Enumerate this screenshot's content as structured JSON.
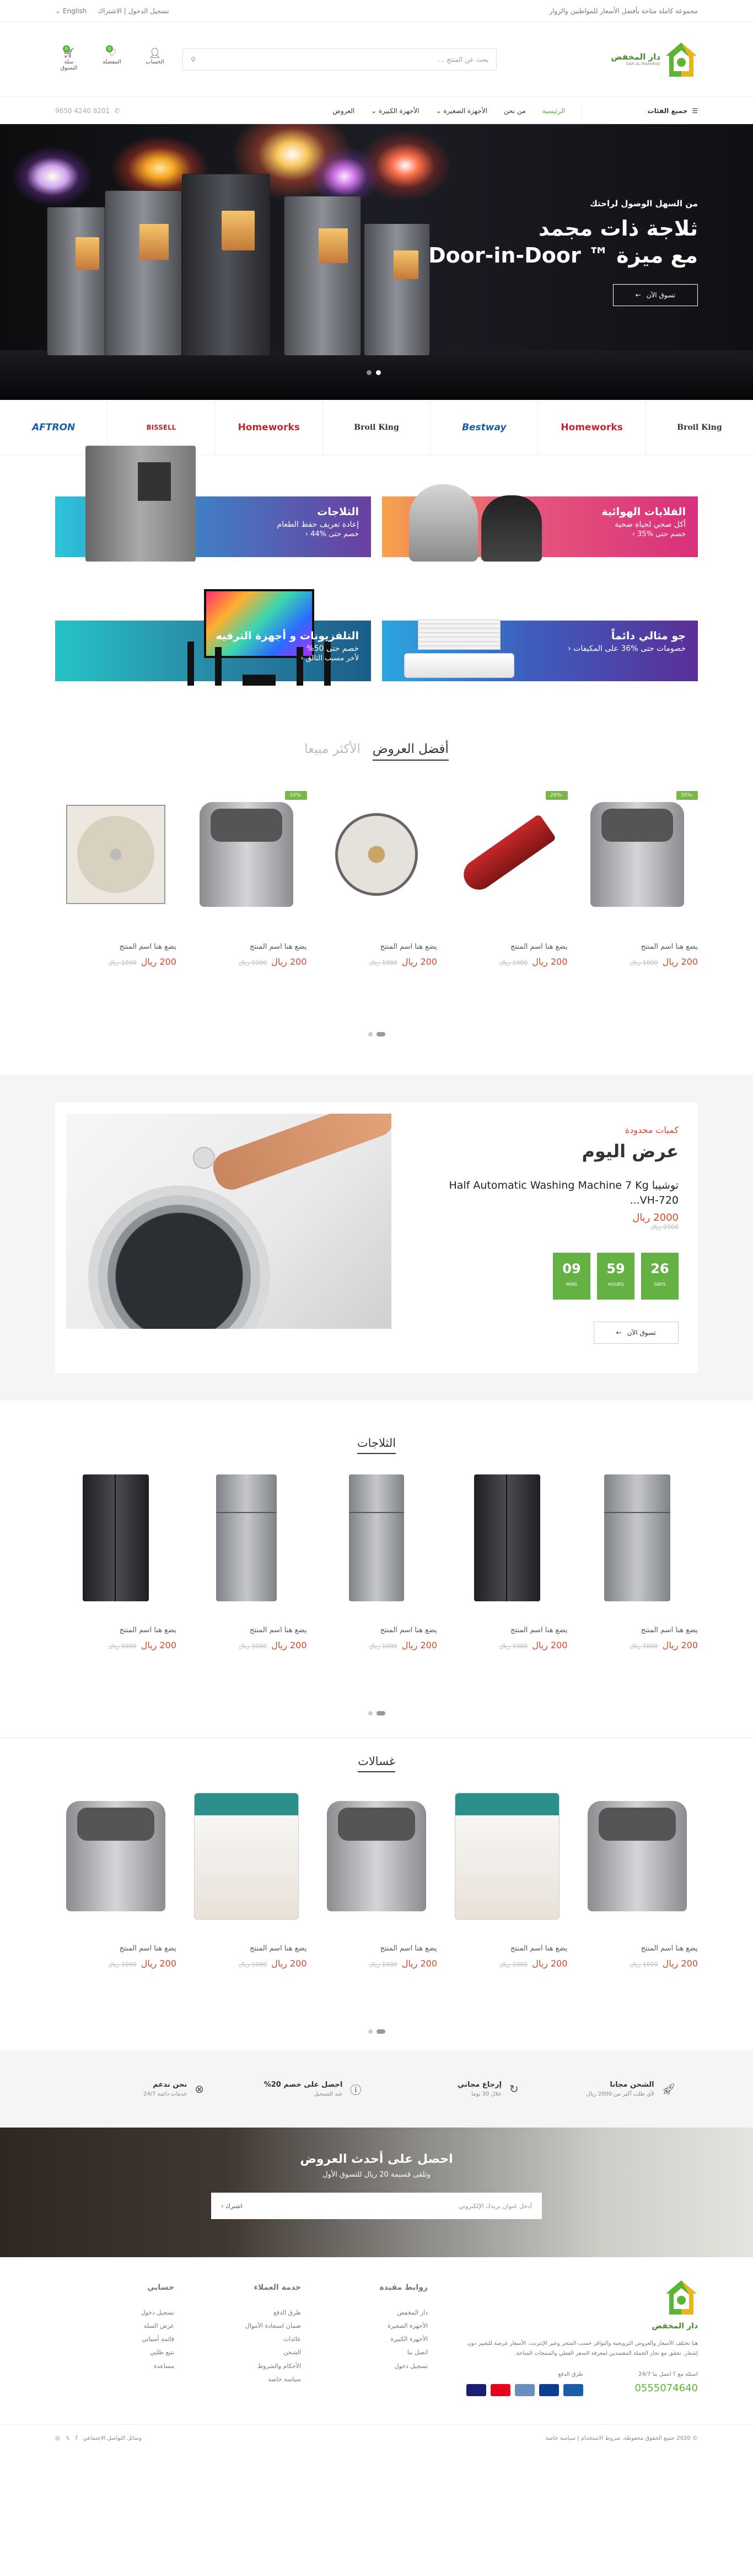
{
  "topbar": {
    "tagline": "مجموعة كاملة متاحة بأفضل الأسعار للمواطنين والزوار",
    "login": "تسجيل الدخول | الاشتراك",
    "lang": "English"
  },
  "header": {
    "logo_name": "دار المخفض",
    "logo_sub": "DAR AL MAKHFAD",
    "search_placeholder": "بحث عن المنتج ...",
    "icons": [
      {
        "label": "الحساب"
      },
      {
        "label": "المفضلة",
        "count": "0"
      },
      {
        "label": "سلة التسوق",
        "count": "0"
      }
    ]
  },
  "nav": {
    "all_categories": "جميع الفئات",
    "links": [
      "الرئيسية",
      "من نحن",
      "الأجهزة الصغيرة",
      "الأجهزة الكبيرة",
      "العروض"
    ],
    "phone": "8201 4240 9650"
  },
  "hero": {
    "small": "من السهل الوصول لراحتك",
    "title_line1": "ثلاجة ذات مجمد",
    "title_line2": "مع ميزة ™ Door-in-Door",
    "button": "تسوق الآن"
  },
  "brands": [
    "Broil King",
    "Homeworks",
    "Bestway",
    "Broil King",
    "Homeworks",
    "BISSELL",
    "AFTRON"
  ],
  "promos": [
    {
      "title": "القلايات الهوائية",
      "line1": "أكل صحي لحياة صحية",
      "line2": "خصم حتى %35 ‹",
      "color": "#d9307b"
    },
    {
      "title": "الثلاجات",
      "line1": "إعادة تعريف حفظ الطعام",
      "line2": "خصم حتى %44 ‹",
      "color": "#6a3fa0"
    },
    {
      "title": "جو مثالي دائماً",
      "line1": "خصومات حتى %36 على المكيفات ‹",
      "line2": "",
      "color": "#3a3fa0"
    },
    {
      "title": "التلفزيونات و أجهزة الترفيه",
      "line1": "خصم حتى 50%",
      "line2": "لأخر مسبب التالق ‹",
      "color": "#1c5d8a"
    }
  ],
  "tabs": {
    "active": "أفضل العروض",
    "inactive": "الأكثر مبيعا"
  },
  "best": [
    {
      "name": "يضع هنا اسم المنتج",
      "price": "200 ريال",
      "old": "1000 ريال",
      "tag": "-35%"
    },
    {
      "name": "يضع هنا اسم المنتج",
      "price": "200 ريال",
      "old": "1000 ريال",
      "tag": "-20%"
    },
    {
      "name": "يضع هنا اسم المنتج",
      "price": "200 ريال",
      "old": "1000 ريال",
      "tag": ""
    },
    {
      "name": "يضع هنا اسم المنتج",
      "price": "200 ريال",
      "old": "1000 ريال",
      "tag": "-10%"
    },
    {
      "name": "يضع هنا اسم المنتج",
      "price": "200 ريال",
      "old": "1000 ريال",
      "tag": ""
    }
  ],
  "deal": {
    "limited": "كميات محدودة",
    "title": "عرض اليوم",
    "product": "توشيبا Half Automatic Washing Machine 7 Kg VH-720...",
    "price": "2000 ريال",
    "old": "2500 ريال",
    "countdown": [
      {
        "n": "26",
        "l": "DAYS"
      },
      {
        "n": "59",
        "l": "HOURS"
      },
      {
        "n": "09",
        "l": "MINS"
      }
    ],
    "button": "تسوق الآن"
  },
  "fridges": {
    "title": "الثلاجات",
    "items": [
      {
        "name": "يضع هنا اسم المنتج",
        "price": "200 ريال",
        "old": "1000 ريال"
      },
      {
        "name": "يضع هنا اسم المنتج",
        "price": "200 ريال",
        "old": "1000 ريال"
      },
      {
        "name": "يضع هنا اسم المنتج",
        "price": "200 ريال",
        "old": "1000 ريال"
      },
      {
        "name": "يضع هنا اسم المنتج",
        "price": "200 ريال",
        "old": "1000 ريال"
      },
      {
        "name": "يضع هنا اسم المنتج",
        "price": "200 ريال",
        "old": "1000 ريال"
      }
    ]
  },
  "washers": {
    "title": "غسالات",
    "items": [
      {
        "name": "يضع هنا اسم المنتج",
        "price": "200 ريال",
        "old": "1000 ريال"
      },
      {
        "name": "يضع هنا اسم المنتج",
        "price": "200 ريال",
        "old": "1000 ريال"
      },
      {
        "name": "يضع هنا اسم المنتج",
        "price": "200 ريال",
        "old": "1000 ريال"
      },
      {
        "name": "يضع هنا اسم المنتج",
        "price": "200 ريال",
        "old": "1000 ريال"
      },
      {
        "name": "يضع هنا اسم المنتج",
        "price": "200 ريال",
        "old": "1000 ريال"
      }
    ]
  },
  "features": [
    {
      "h": "الشحن مجانا",
      "s": "لأي طلب أكبر من 2000 ريال"
    },
    {
      "h": "إرجاع مجاني",
      "s": "خلال 30 يوما"
    },
    {
      "h": "احصل على خصم 20%",
      "s": "عند التسجيل"
    },
    {
      "h": "نحن ندعم",
      "s": "خدمات دائمة 24/7"
    }
  ],
  "newsletter": {
    "title": "احصل على أحدث العروض",
    "sub": "وتلقى قسيمة 20 ريال للتسوق الأول",
    "placeholder": "أدخل عنوان بريدك الإلكتروني",
    "button": "اشترك ‹"
  },
  "footer": {
    "about": "هنا تختلف الأسعار والعروض الترويجية والتوافر حسب المتجر وعبر الإنترنت. الأسعار عرضة للتغيير دون إشعار. تحقق مع تجار الجملة المعتمدين لمعرفة السعر الفعلي والمنتجات المتاحة.",
    "question": "اسئلة مع ؟ اتصل بنا 24/7",
    "phone": "0555074640",
    "pay_label": "طرق الدفع",
    "cols": [
      {
        "h": "روابط مفيدة",
        "items": [
          "دار المخفض",
          "الأجهزة الصغيرة",
          "الأجهزة الكبيرة",
          "اتصل بنا",
          "تسجيل دخول"
        ]
      },
      {
        "h": "خدمة العملاء",
        "items": [
          "طرق الدفع",
          "ضمان استعادة الأموال",
          "عائدات",
          "الشحن",
          "الأحكام والشروط",
          "سياسة خاصة"
        ]
      },
      {
        "h": "حسابي",
        "items": [
          "تسجيل دخول",
          "عرض السلة",
          "قائمة أمنياتي",
          "تتبع طلبي",
          "مساعدة"
        ]
      }
    ],
    "copyright": "© 2020 جميع الحقوق محفوظة. شروط الاستخدام | سياسة خاصة",
    "social": "وسائل التواصل الاجتماعي"
  }
}
